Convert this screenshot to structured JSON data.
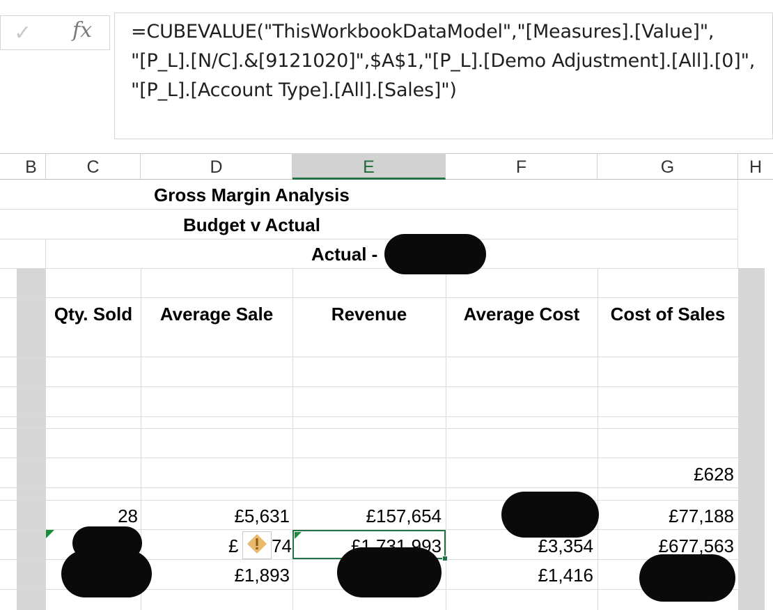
{
  "formula_bar": {
    "confirm_icon": "checkmark-icon",
    "fx_label": "fx",
    "lines": [
      "=CUBEVALUE(\"ThisWorkbookDataModel\",\"[Measures].[Value]\",",
      "\"[P_L].[N/C].&[9121020]\",$A$1,\"[P_L].[Demo Adjustment].[All].[0]\",",
      "\"[P_L].[Account Type].[All].[Sales]\")"
    ]
  },
  "columns": [
    "B",
    "C",
    "D",
    "E",
    "F",
    "G",
    "H"
  ],
  "selected_column": "E",
  "sheet": {
    "title": "Gross Margin Analysis",
    "subtitle": "Budget v Actual",
    "period_label": "Actual -",
    "headers": [
      "Qty. Sold",
      "Average Sale",
      "Revenue",
      "Average Cost",
      "Cost of Sales"
    ],
    "rows": [
      {
        "qty": "",
        "avg_sale": "",
        "revenue": "",
        "avg_cost": "",
        "cost_of_sales": "£628"
      },
      {
        "qty": "28",
        "avg_sale": "£5,631",
        "revenue": "£157,654",
        "avg_cost": "",
        "cost_of_sales": "£77,188"
      },
      {
        "qty": "",
        "avg_sale_left": "£",
        "avg_sale_right": "74",
        "revenue": "£1,731,993",
        "avg_cost": "£3,354",
        "cost_of_sales": "£677,563"
      },
      {
        "qty": "",
        "avg_sale": "£1,893",
        "revenue": "",
        "avg_cost": "£1,416",
        "cost_of_sales": ""
      }
    ]
  },
  "colors": {
    "selection": "#217346",
    "warning": "#e8b86b",
    "gridline": "#dadada"
  }
}
